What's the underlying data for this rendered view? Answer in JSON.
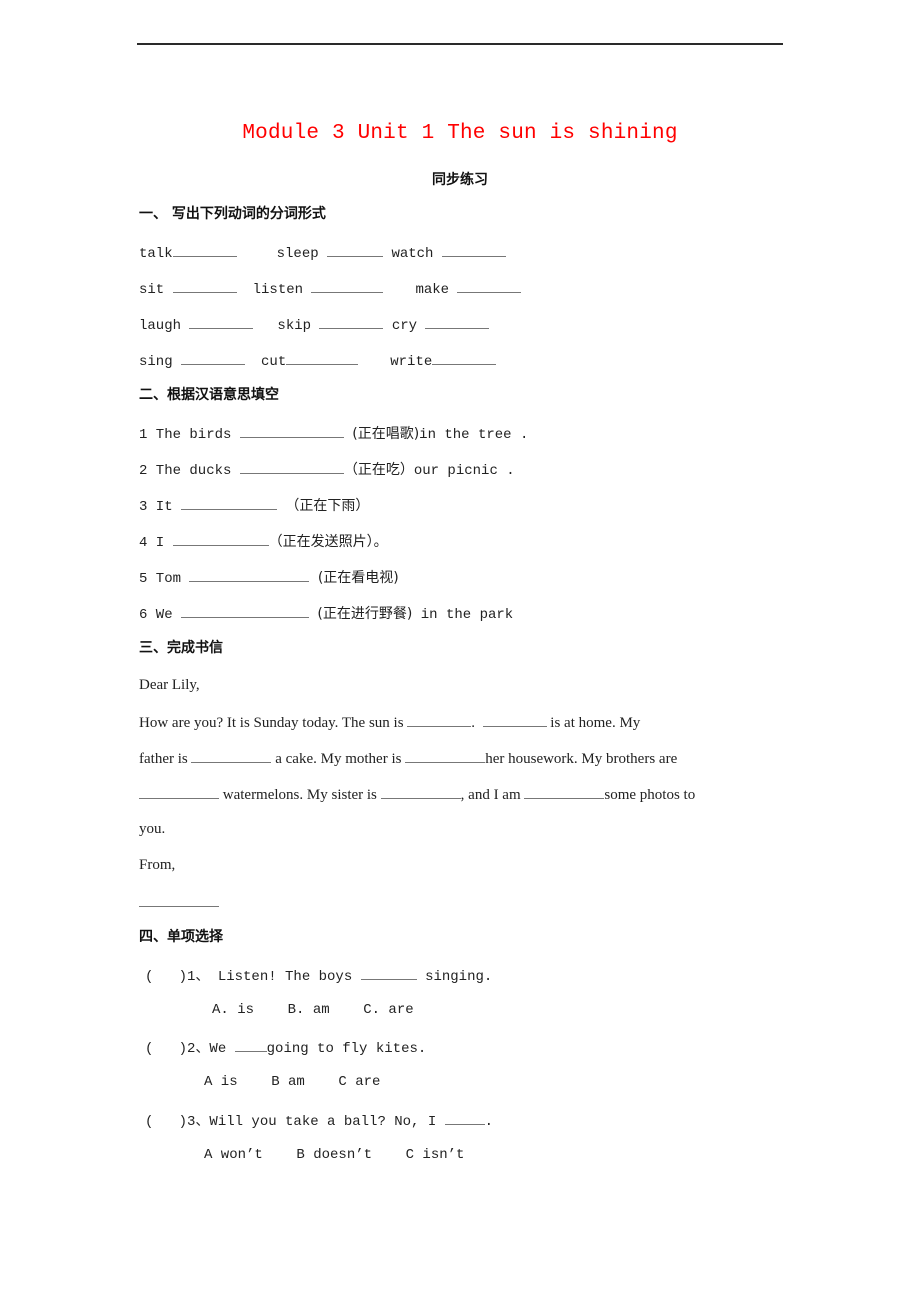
{
  "document": {
    "title": "Module 3 Unit 1 The sun is shining",
    "subtitle": "同步练习",
    "sections": [
      {
        "heading": "一、 写出下列动词的分词形式",
        "rows": [
          [
            "talk",
            "sleep",
            "watch"
          ],
          [
            "sit",
            "listen",
            "make"
          ],
          [
            "laugh",
            "skip",
            "cry"
          ],
          [
            "sing",
            "cut",
            "write"
          ]
        ]
      },
      {
        "heading": "二、根据汉语意思填空",
        "items": [
          {
            "pre": "1 The birds",
            "hint": "(正在唱歌)",
            "post": "in the tree ."
          },
          {
            "pre": "2 The ducks",
            "hint": "（正在吃）",
            "post": "our picnic ."
          },
          {
            "pre": "3 It",
            "hint": "（正在下雨）",
            "post": ""
          },
          {
            "pre": "4 I",
            "hint": "（正在发送照片）。",
            "post": ""
          },
          {
            "pre": "5 Tom",
            "hint": "(正在看电视)",
            "post": ""
          },
          {
            "pre": "6 We",
            "hint": "(正在进行野餐)",
            "post": "in the park"
          }
        ]
      },
      {
        "heading": "三、完成书信",
        "greeting": "Dear Lily,",
        "l1a": "How are you? It is Sunday today. The sun is",
        "l1b": ".",
        "l1c": "is at home. My",
        "l2a": "father is",
        "l2b": "a cake. My mother is",
        "l2c": "her housework. My brothers are",
        "l3a": "watermelons. My sister is",
        "l3b": ", and I am",
        "l3c": "some photos to",
        "l4": "you.",
        "closing": "From,"
      },
      {
        "heading": "四、单项选择",
        "questions": [
          {
            "bracket": "(   )",
            "stem_a": "1、 Listen! The boys",
            "stem_b": "singing.",
            "options": "A. is    B. am    C. are"
          },
          {
            "bracket": "(   )",
            "stem_a": "2、We",
            "stem_b": "going to fly kites.",
            "options": "A is    B am    C are"
          },
          {
            "bracket": "(   )",
            "stem_a": "3、Will you take a ball? No, I",
            "stem_b": ".",
            "options": "A won’t    B doesn’t    C isn’t"
          }
        ]
      }
    ]
  }
}
